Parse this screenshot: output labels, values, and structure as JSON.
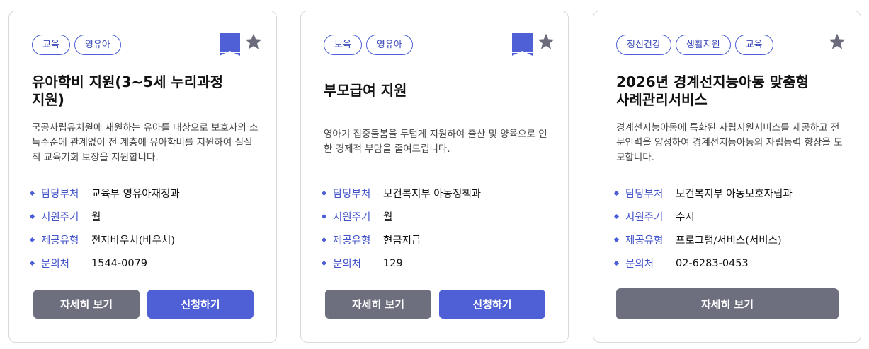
{
  "colors": {
    "accent": "#4f5fd6",
    "gray_button": "#6d6f7f",
    "star": "#6a6b7b"
  },
  "cards": [
    {
      "tags": [
        "교육",
        "영유아"
      ],
      "bookmarked": true,
      "title": "유아학비 지원(3~5세 누리과정 지원)",
      "description": "국공사립유치원에 재원하는 유아를 대상으로 보호자의 소득수준에 관계없이 전 계층에 유아학비를 지원하여 실질적 교육기회 보장을 지원합니다.",
      "info": [
        {
          "label": "담당부처",
          "value": "교육부 영유아재정과"
        },
        {
          "label": "지원주기",
          "value": "월"
        },
        {
          "label": "제공유형",
          "value": "전자바우처(바우처)"
        },
        {
          "label": "문의처",
          "value": "1544-0079"
        }
      ],
      "detail_label": "자세히 보기",
      "apply_label": "신청하기"
    },
    {
      "tags": [
        "보육",
        "영유아"
      ],
      "bookmarked": true,
      "title": "부모급여 지원",
      "description": "영아기 집중돌봄을 두텁게 지원하여 출산 및 양육으로 인한 경제적 부담을 줄여드립니다.",
      "info": [
        {
          "label": "담당부처",
          "value": "보건복지부 아동정책과"
        },
        {
          "label": "지원주기",
          "value": "월"
        },
        {
          "label": "제공유형",
          "value": "현금지급"
        },
        {
          "label": "문의처",
          "value": "129"
        }
      ],
      "detail_label": "자세히 보기",
      "apply_label": "신청하기"
    },
    {
      "tags": [
        "정신건강",
        "생활지원",
        "교육"
      ],
      "bookmarked": false,
      "title": "2026년 경계선지능아동 맞춤형 사례관리서비스",
      "description": "경계선지능아동에 특화된 자립지원서비스를 제공하고 전문인력을 양성하여 경계선지능아동의 자립능력 향상을 도모합니다.",
      "info": [
        {
          "label": "담당부처",
          "value": "보건복지부 아동보호자립과"
        },
        {
          "label": "지원주기",
          "value": "수시"
        },
        {
          "label": "제공유형",
          "value": "프로그램/서비스(서비스)"
        },
        {
          "label": "문의처",
          "value": "02-6283-0453"
        }
      ],
      "detail_label": "자세히 보기"
    }
  ]
}
